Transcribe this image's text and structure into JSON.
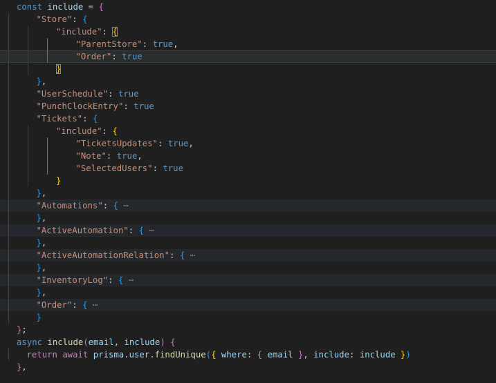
{
  "editor": {
    "language": "javascript",
    "active_line": 4,
    "lines": [
      {
        "indent": 0,
        "tokens": [
          {
            "t": "const ",
            "c": "kw"
          },
          {
            "t": "include",
            "c": "var"
          },
          {
            "t": " = ",
            "c": "punc"
          },
          {
            "t": "{",
            "c": "b2"
          }
        ]
      },
      {
        "indent": 1,
        "tokens": [
          {
            "t": "\"Store\"",
            "c": "str"
          },
          {
            "t": ": ",
            "c": "punc"
          },
          {
            "t": "{",
            "c": "b3"
          }
        ]
      },
      {
        "indent": 2,
        "tokens": [
          {
            "t": "\"include\"",
            "c": "str"
          },
          {
            "t": ": ",
            "c": "punc"
          },
          {
            "t": "{",
            "c": "b1",
            "m": true
          }
        ]
      },
      {
        "indent": 3,
        "tokens": [
          {
            "t": "\"ParentStore\"",
            "c": "str"
          },
          {
            "t": ": ",
            "c": "punc"
          },
          {
            "t": "true",
            "c": "bool"
          },
          {
            "t": ",",
            "c": "punc"
          }
        ]
      },
      {
        "indent": 3,
        "tokens": [
          {
            "t": "\"Order\"",
            "c": "str"
          },
          {
            "t": ": ",
            "c": "punc"
          },
          {
            "t": "true",
            "c": "bool"
          }
        ]
      },
      {
        "indent": 2,
        "tokens": [
          {
            "t": "}",
            "c": "b1",
            "m": true
          }
        ]
      },
      {
        "indent": 1,
        "tokens": [
          {
            "t": "}",
            "c": "b3"
          },
          {
            "t": ",",
            "c": "punc"
          }
        ]
      },
      {
        "indent": 1,
        "tokens": [
          {
            "t": "\"UserSchedule\"",
            "c": "str"
          },
          {
            "t": ": ",
            "c": "punc"
          },
          {
            "t": "true",
            "c": "bool"
          }
        ]
      },
      {
        "indent": 1,
        "tokens": [
          {
            "t": "\"PunchClockEntry\"",
            "c": "str"
          },
          {
            "t": ": ",
            "c": "punc"
          },
          {
            "t": "true",
            "c": "bool"
          }
        ]
      },
      {
        "indent": 1,
        "tokens": [
          {
            "t": "\"Tickets\"",
            "c": "str"
          },
          {
            "t": ": ",
            "c": "punc"
          },
          {
            "t": "{",
            "c": "b3"
          }
        ]
      },
      {
        "indent": 2,
        "tokens": [
          {
            "t": "\"include\"",
            "c": "str"
          },
          {
            "t": ": ",
            "c": "punc"
          },
          {
            "t": "{",
            "c": "b1"
          }
        ]
      },
      {
        "indent": 3,
        "tokens": [
          {
            "t": "\"TicketsUpdates\"",
            "c": "str"
          },
          {
            "t": ": ",
            "c": "punc"
          },
          {
            "t": "true",
            "c": "bool"
          },
          {
            "t": ",",
            "c": "punc"
          }
        ]
      },
      {
        "indent": 3,
        "tokens": [
          {
            "t": "\"Note\"",
            "c": "str"
          },
          {
            "t": ": ",
            "c": "punc"
          },
          {
            "t": "true",
            "c": "bool"
          },
          {
            "t": ",",
            "c": "punc"
          }
        ]
      },
      {
        "indent": 3,
        "tokens": [
          {
            "t": "\"SelectedUsers\"",
            "c": "str"
          },
          {
            "t": ": ",
            "c": "punc"
          },
          {
            "t": "true",
            "c": "bool"
          }
        ]
      },
      {
        "indent": 2,
        "tokens": [
          {
            "t": "}",
            "c": "b1"
          }
        ]
      },
      {
        "indent": 1,
        "tokens": [
          {
            "t": "}",
            "c": "b3"
          },
          {
            "t": ",",
            "c": "punc"
          }
        ]
      },
      {
        "indent": 1,
        "folded": true,
        "tokens": [
          {
            "t": "\"Automations\"",
            "c": "str"
          },
          {
            "t": ": ",
            "c": "punc"
          },
          {
            "t": "{",
            "c": "b3"
          },
          {
            "t": " ⋯",
            "c": "ell"
          }
        ]
      },
      {
        "indent": 1,
        "tokens": [
          {
            "t": "}",
            "c": "b3"
          },
          {
            "t": ",",
            "c": "punc"
          }
        ]
      },
      {
        "indent": 1,
        "folded": true,
        "tokens": [
          {
            "t": "\"ActiveAutomation\"",
            "c": "str"
          },
          {
            "t": ": ",
            "c": "punc"
          },
          {
            "t": "{",
            "c": "b3"
          },
          {
            "t": " ⋯",
            "c": "ell"
          }
        ]
      },
      {
        "indent": 1,
        "tokens": [
          {
            "t": "}",
            "c": "b3"
          },
          {
            "t": ",",
            "c": "punc"
          }
        ]
      },
      {
        "indent": 1,
        "folded": true,
        "tokens": [
          {
            "t": "\"ActiveAutomationRelation\"",
            "c": "str"
          },
          {
            "t": ": ",
            "c": "punc"
          },
          {
            "t": "{",
            "c": "b3"
          },
          {
            "t": " ⋯",
            "c": "ell"
          }
        ]
      },
      {
        "indent": 1,
        "tokens": [
          {
            "t": "}",
            "c": "b3"
          },
          {
            "t": ",",
            "c": "punc"
          }
        ]
      },
      {
        "indent": 1,
        "folded": true,
        "tokens": [
          {
            "t": "\"InventoryLog\"",
            "c": "str"
          },
          {
            "t": ": ",
            "c": "punc"
          },
          {
            "t": "{",
            "c": "b3"
          },
          {
            "t": " ⋯",
            "c": "ell"
          }
        ]
      },
      {
        "indent": 1,
        "tokens": [
          {
            "t": "}",
            "c": "b3"
          },
          {
            "t": ",",
            "c": "punc"
          }
        ]
      },
      {
        "indent": 1,
        "folded": true,
        "tokens": [
          {
            "t": "\"Order\"",
            "c": "str"
          },
          {
            "t": ": ",
            "c": "punc"
          },
          {
            "t": "{",
            "c": "b3"
          },
          {
            "t": " ⋯",
            "c": "ell"
          }
        ]
      },
      {
        "indent": 1,
        "tokens": [
          {
            "t": "}",
            "c": "b3"
          }
        ]
      },
      {
        "indent": 0,
        "tokens": [
          {
            "t": "}",
            "c": "b2"
          },
          {
            "t": ";",
            "c": "punc"
          }
        ]
      },
      {
        "indent": 0,
        "tokens": [
          {
            "t": "async ",
            "c": "kw"
          },
          {
            "t": "include",
            "c": "fn"
          },
          {
            "t": "(",
            "c": "b2"
          },
          {
            "t": "email",
            "c": "var"
          },
          {
            "t": ", ",
            "c": "punc"
          },
          {
            "t": "include",
            "c": "var"
          },
          {
            "t": ")",
            "c": "b2"
          },
          {
            "t": " ",
            "c": "punc"
          },
          {
            "t": "{",
            "c": "b2"
          }
        ]
      },
      {
        "indent": 0,
        "pad": 1,
        "tokens": [
          {
            "t": "return ",
            "c": "ctl"
          },
          {
            "t": "await ",
            "c": "ctl"
          },
          {
            "t": "prisma",
            "c": "var"
          },
          {
            "t": ".",
            "c": "punc"
          },
          {
            "t": "user",
            "c": "var"
          },
          {
            "t": ".",
            "c": "punc"
          },
          {
            "t": "findUnique",
            "c": "fn"
          },
          {
            "t": "(",
            "c": "b3"
          },
          {
            "t": "{",
            "c": "b1"
          },
          {
            "t": " where",
            "c": "var"
          },
          {
            "t": ": ",
            "c": "punc"
          },
          {
            "t": "{",
            "c": "b2"
          },
          {
            "t": " email ",
            "c": "var"
          },
          {
            "t": "}",
            "c": "b2"
          },
          {
            "t": ", ",
            "c": "punc"
          },
          {
            "t": "include",
            "c": "var"
          },
          {
            "t": ": ",
            "c": "punc"
          },
          {
            "t": "include",
            "c": "var"
          },
          {
            "t": " ",
            "c": "punc"
          },
          {
            "t": "}",
            "c": "b1"
          },
          {
            "t": ")",
            "c": "b3"
          }
        ]
      },
      {
        "indent": 0,
        "tokens": [
          {
            "t": "}",
            "c": "b2"
          },
          {
            "t": ",",
            "c": "punc"
          }
        ]
      }
    ]
  },
  "theme": {
    "background": "#1f1f1f",
    "current_line": "#2a2d2e",
    "keyword": "#569cd6",
    "control": "#c586c0",
    "variable": "#9cdcfe",
    "string": "#ce9178",
    "function": "#dcdcaa",
    "bracket_gold": "#ffd700",
    "bracket_orchid": "#da70d6",
    "bracket_blue": "#179fff"
  }
}
